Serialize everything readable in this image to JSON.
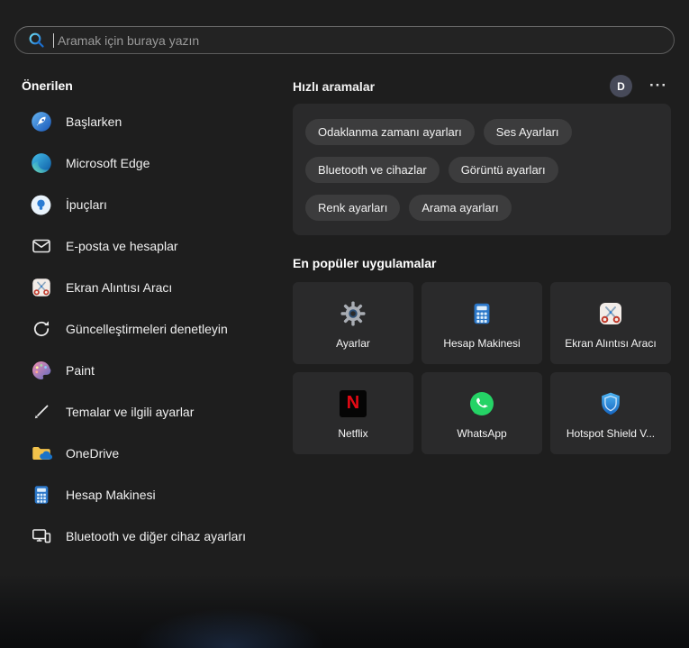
{
  "search": {
    "placeholder": "Aramak için buraya yazın"
  },
  "suggested": {
    "title": "Önerilen",
    "items": [
      {
        "label": "Başlarken",
        "icon": "getting-started-icon"
      },
      {
        "label": "Microsoft Edge",
        "icon": "edge-icon"
      },
      {
        "label": "İpuçları",
        "icon": "tips-icon"
      },
      {
        "label": "E-posta ve hesaplar",
        "icon": "mail-icon"
      },
      {
        "label": "Ekran Alıntısı Aracı",
        "icon": "snipping-tool-icon"
      },
      {
        "label": "Güncelleştirmeleri denetleyin",
        "icon": "refresh-icon"
      },
      {
        "label": "Paint",
        "icon": "paint-palette-icon"
      },
      {
        "label": "Temalar ve ilgili ayarlar",
        "icon": "brush-icon"
      },
      {
        "label": "OneDrive",
        "icon": "onedrive-icon"
      },
      {
        "label": "Hesap Makinesi",
        "icon": "calculator-icon"
      },
      {
        "label": "Bluetooth ve diğer cihaz ayarları",
        "icon": "devices-icon"
      }
    ]
  },
  "header": {
    "avatar_initial": "D",
    "more_glyph": "···"
  },
  "quick_searches": {
    "title": "Hızlı aramalar",
    "chips": [
      "Odaklanma zamanı ayarları",
      "Ses Ayarları",
      "Bluetooth ve cihazlar",
      "Görüntü ayarları",
      "Renk ayarları",
      "Arama ayarları"
    ]
  },
  "top_apps": {
    "title": "En popüler uygulamalar",
    "apps": [
      {
        "label": "Ayarlar",
        "icon": "settings-gear-icon"
      },
      {
        "label": "Hesap Makinesi",
        "icon": "calculator-icon"
      },
      {
        "label": "Ekran Alıntısı Aracı",
        "icon": "snipping-tool-icon"
      },
      {
        "label": "Netflix",
        "icon": "netflix-icon",
        "logo_letter": "N"
      },
      {
        "label": "WhatsApp",
        "icon": "whatsapp-icon"
      },
      {
        "label": "Hotspot Shield V...",
        "icon": "shield-icon"
      }
    ]
  },
  "colors": {
    "background": "#1e1e1e",
    "card": "#2a2a2b",
    "chip": "#3c3c3d",
    "netflix_red": "#e50914",
    "whatsapp_green": "#25d366"
  }
}
